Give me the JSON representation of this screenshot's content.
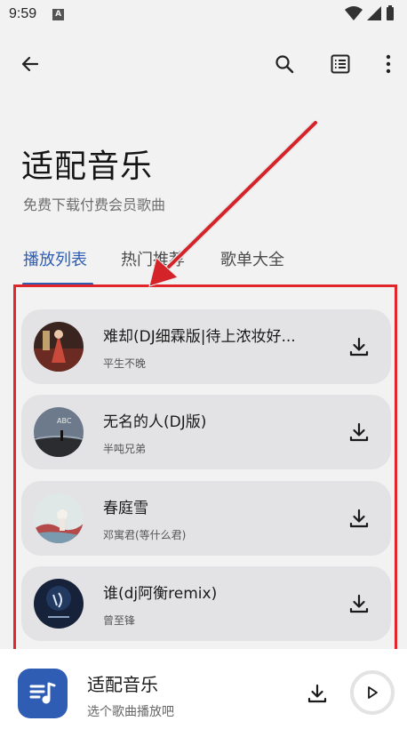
{
  "status_bar": {
    "time": "9:59",
    "notif_letter": "A"
  },
  "header": {
    "title": "适配音乐",
    "subtitle": "免费下载付费会员歌曲"
  },
  "tabs": [
    {
      "label": "播放列表",
      "active": true
    },
    {
      "label": "热门推荐",
      "active": false
    },
    {
      "label": "歌单大全",
      "active": false
    }
  ],
  "songs": [
    {
      "title": "难却(DJ细霖版|待上浓妆好...",
      "artist": "平生不晚"
    },
    {
      "title": "无名的人(DJ版)",
      "artist": "半吨兄弟"
    },
    {
      "title": "春庭雪",
      "artist": "邓寓君(等什么君)"
    },
    {
      "title": "谁(dj阿衡remix)",
      "artist": "曾至锋"
    }
  ],
  "player": {
    "title": "适配音乐",
    "subtitle": "选个歌曲播放吧"
  },
  "colors": {
    "accent": "#2f5db4",
    "annotation": "#e0262b",
    "card": "#e3e3e5",
    "background": "#f2f2f2"
  }
}
